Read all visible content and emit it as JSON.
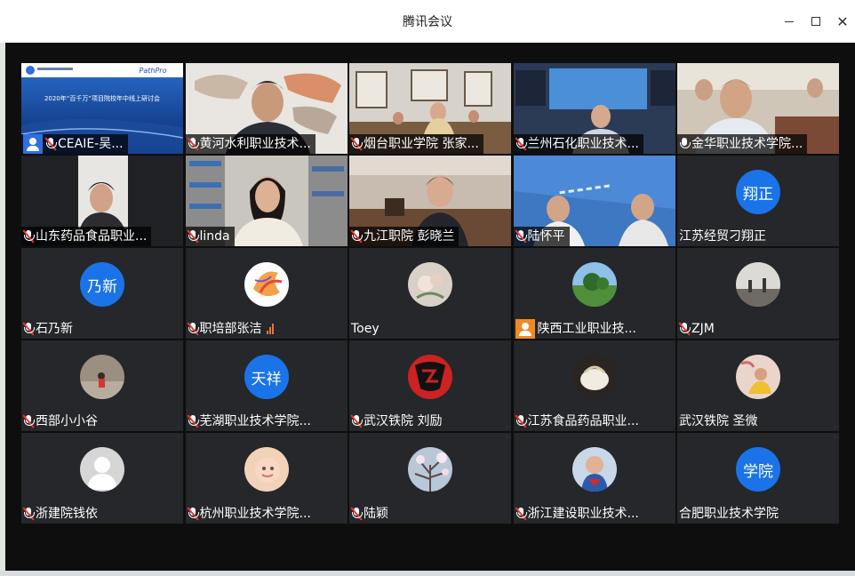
{
  "window": {
    "title": "腾讯会议",
    "controls": {
      "minimize": "minimize",
      "maximize": "maximize",
      "close": "close"
    }
  },
  "slide": {
    "brand": "PathPro",
    "title": "2020年“百千万”项目院校年中线上研讨会"
  },
  "participants": [
    {
      "name": "CEAIE-吴...",
      "icon": "user-icon",
      "muted": true,
      "kind": "slide"
    },
    {
      "name": "黄河水利职业技术...",
      "muted": true,
      "kind": "video"
    },
    {
      "name": "烟台职业学院 张家...",
      "muted": true,
      "kind": "video"
    },
    {
      "name": "兰州石化职业技术...",
      "muted": true,
      "kind": "video"
    },
    {
      "name": "金华职业技术学院...",
      "muted": false,
      "kind": "video"
    },
    {
      "name": "山东药品食品职业...",
      "muted": true,
      "kind": "video"
    },
    {
      "name": "linda",
      "muted": true,
      "kind": "video"
    },
    {
      "name": "九江职院 彭晓兰",
      "muted": true,
      "kind": "video"
    },
    {
      "name": "陆怀平",
      "muted": true,
      "kind": "video"
    },
    {
      "name": "江苏经贸刁翔正",
      "avatar_text": "翔正",
      "muted": false,
      "kind": "avatar"
    },
    {
      "name": "石乃新",
      "avatar_text": "乃新",
      "muted": true,
      "kind": "avatar"
    },
    {
      "name": "职培部张洁",
      "muted": true,
      "kind": "photo",
      "signal": true
    },
    {
      "name": "Toey",
      "muted": false,
      "kind": "photo"
    },
    {
      "name": "陕西工业职业技...",
      "icon": "user-icon",
      "muted": false,
      "kind": "photo"
    },
    {
      "name": "ZJM",
      "muted": true,
      "kind": "photo"
    },
    {
      "name": "西部小小谷",
      "muted": true,
      "kind": "photo"
    },
    {
      "name": "芜湖职业技术学院...",
      "avatar_text": "天祥",
      "muted": true,
      "kind": "avatar"
    },
    {
      "name": "武汉铁院 刘励",
      "muted": true,
      "kind": "photo"
    },
    {
      "name": "江苏食品药品职业...",
      "muted": true,
      "kind": "photo"
    },
    {
      "name": "武汉铁院 圣微",
      "muted": false,
      "kind": "photo"
    },
    {
      "name": "浙建院钱依",
      "muted": true,
      "kind": "photo"
    },
    {
      "name": "杭州职业技术学院...",
      "muted": true,
      "kind": "photo"
    },
    {
      "name": "陆颖",
      "muted": true,
      "kind": "photo"
    },
    {
      "name": "浙江建设职业技术...",
      "muted": true,
      "kind": "photo"
    },
    {
      "name": "合肥职业技术学院",
      "avatar_text": "学院",
      "muted": false,
      "kind": "avatar"
    }
  ],
  "colors": {
    "tile": "#25272a",
    "stage": "#0e0e0e",
    "avatar_blue": "#1a73e8",
    "mic_muted": "#e53935"
  }
}
